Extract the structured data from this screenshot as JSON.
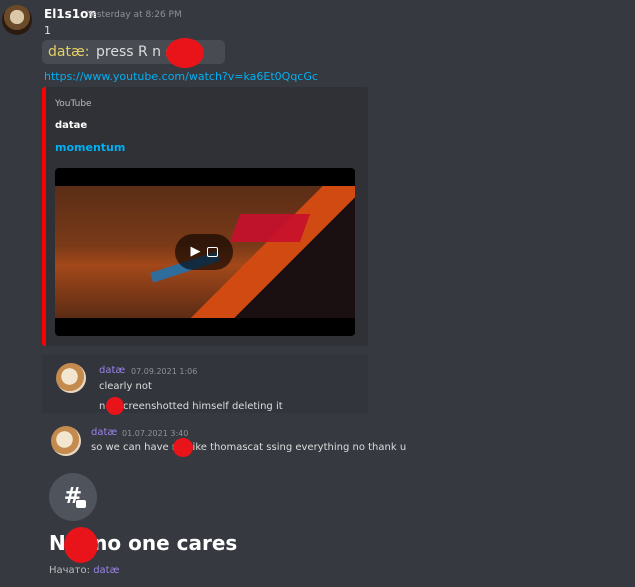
{
  "message": {
    "author": "El1s1on",
    "timestamp": "Yesterday at 8:26 PM",
    "line1": "1",
    "quote": {
      "name": "datæ:",
      "text": "press R n s"
    },
    "link": "https://www.youtube.com/watch?v=ka6Et0QqcGc",
    "embed": {
      "provider": "YouTube",
      "author": "datae",
      "title": "momentum",
      "accent_color": "#ff0000"
    }
  },
  "replies": [
    {
      "author": "datæ",
      "time": "07.09.2021 1:06",
      "lines": [
        "clearly not",
        "n a screenshotted himself deleting it"
      ]
    },
    {
      "author": "datæ",
      "time": "01.07.2021 3:40",
      "lines": [
        "so we can have n s like thomascat ssing everything no thank u"
      ]
    }
  ],
  "thread": {
    "icon": "thread-hash-icon",
    "title": "N a no one cares",
    "started_label": "Начато:",
    "started_by": "datæ"
  },
  "colors": {
    "background": "#36393f",
    "link": "#00b0f4",
    "username_purple": "#9b84ec",
    "quote_gold": "#e3cf63"
  }
}
